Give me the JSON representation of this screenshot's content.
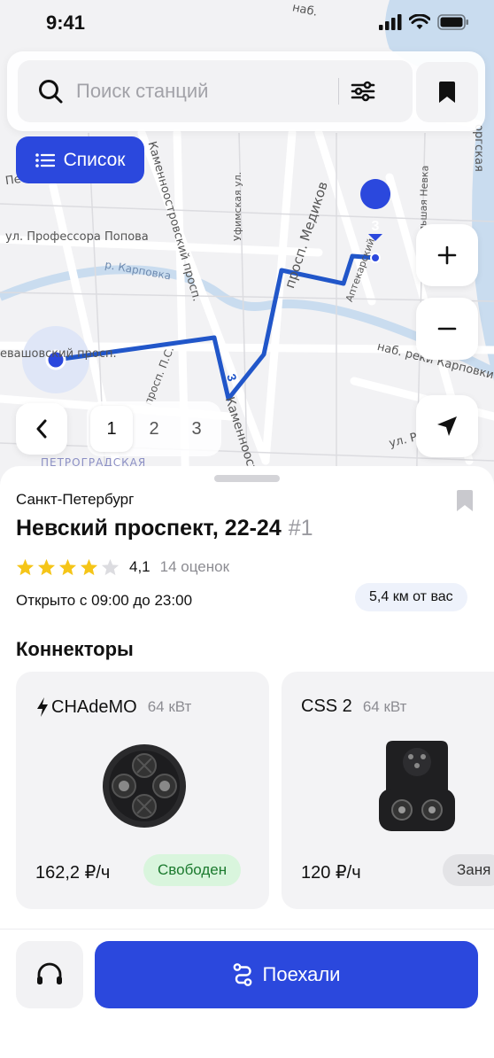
{
  "status_bar": {
    "time": "9:41"
  },
  "map": {
    "labels": {
      "street_1": "наб.",
      "professora": "ул. Профессора Попова",
      "kamennoostrovsky": "Каменноостровский просп.",
      "ufimskaya": "Уфимская ул.",
      "medikov": "просп. Медиков",
      "karpovka": "р. Карповка",
      "aptekarsky": "Аптекарский",
      "nab_karpovki": "наб. реки Карповки",
      "big_nevka": "р. Большая Невка",
      "orgskaya": "оргская",
      "levashovsky": "евашовский просп.",
      "prosp_ps": "просп. П.С.",
      "petrogradskaya": "ПЕТРОГРАДСКАЯ",
      "kamenno_bottom": "Каменноостр",
      "ul_re": "ул. Ре",
      "ped": "Пе"
    },
    "marker_count": "3",
    "route_marker": "3"
  },
  "search": {
    "placeholder": "Поиск станций"
  },
  "list_button": {
    "label": "Список"
  },
  "pager": {
    "pages": [
      "1",
      "2",
      "3"
    ],
    "active": "1"
  },
  "station": {
    "city": "Санкт-Петербург",
    "name": "Невский проспект, 22-24",
    "number": "#1",
    "rating": "4,1",
    "rating_stars": 4,
    "reviews": "14 оценок",
    "hours": "Открыто с 09:00 до 23:00",
    "distance": "5,4 км от вас"
  },
  "connectors": {
    "title": "Коннекторы",
    "items": [
      {
        "name": "CHAdeMO",
        "power": "64 кВт",
        "price": "162,2 ₽/ч",
        "status": "Свободен"
      },
      {
        "name": "CSS 2",
        "power": "64 кВт",
        "price": "120 ₽/ч",
        "status": "Заня"
      }
    ]
  },
  "actions": {
    "go_label": "Поехали"
  },
  "colors": {
    "accent": "#2b48dd",
    "free_bg": "#d9f5dd",
    "free_text": "#1b7a2e",
    "star": "#f5c518",
    "route": "#2156c9"
  },
  "icons": [
    "search-icon",
    "filter-icon",
    "bookmark-icon",
    "list-icon",
    "plus-icon",
    "minus-icon",
    "navigation-arrow-icon",
    "chevron-left-icon",
    "star-icon",
    "lightning-icon",
    "headset-icon",
    "route-icon",
    "signal-icon",
    "wifi-icon",
    "battery-icon"
  ]
}
